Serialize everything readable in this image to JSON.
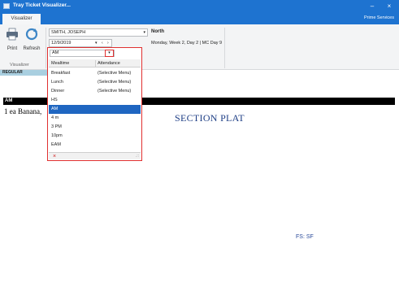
{
  "window": {
    "title": "Tray Ticket Visualizer...",
    "minimize_glyph": "–",
    "close_glyph": "×"
  },
  "ribbon_tabs": {
    "active": "Visualizer",
    "right_label": "Prime Services"
  },
  "toolbar": {
    "print_label": "Print",
    "refresh_label": "Refresh",
    "group_label": "Visualizer",
    "group2_label": "ation"
  },
  "patient": {
    "name": "SMITH, JOSEPH",
    "location": "North",
    "schedule": "Monday, Week 2, Day 2 | MC Day 9"
  },
  "date": {
    "value": "12/9/2019",
    "dropdown_glyph": "▾",
    "prev_glyph": "‹",
    "next_glyph": "›"
  },
  "status_strip": {
    "label": "REGULAR"
  },
  "mealtime_dropdown": {
    "current_value": "AM",
    "arrow_glyph": "▾",
    "columns": [
      "Mealtime",
      "Attendance"
    ],
    "options": [
      {
        "mealtime": "Breakfast",
        "attendance": "(Selective Menu)"
      },
      {
        "mealtime": "Lunch",
        "attendance": "(Selective Menu)"
      },
      {
        "mealtime": "Dinner",
        "attendance": "(Selective Menu)"
      },
      {
        "mealtime": "HS",
        "attendance": ""
      },
      {
        "mealtime": "AM",
        "attendance": ""
      },
      {
        "mealtime": "4 m",
        "attendance": ""
      },
      {
        "mealtime": "3 PM",
        "attendance": ""
      },
      {
        "mealtime": "10pm",
        "attendance": ""
      },
      {
        "mealtime": "EAM",
        "attendance": ""
      }
    ],
    "selected_mealtime": "AM",
    "clear_glyph": "×",
    "resize_glyph": ".::"
  },
  "ticket": {
    "section_header": "AM",
    "item_line": "1 ea Banana,",
    "section_title": "SECTION PLAT",
    "footer_code": "FS: SF"
  },
  "colors": {
    "titlebar": "#1e73d0",
    "selected_row": "#1f66c1",
    "highlight_border": "#e03030",
    "status_strip": "#a9cfe0",
    "section_title": "#1f3f86"
  },
  "icons": {
    "print": "printer-icon",
    "refresh": "refresh-icon",
    "app": "app-window-icon"
  }
}
